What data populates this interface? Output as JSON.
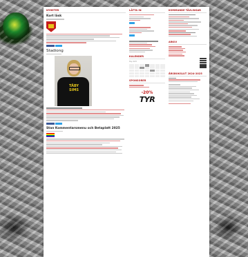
{
  "page": {
    "main": {
      "section_label": "NYHETER",
      "post1_title": "Kort läsk",
      "post2_title": "Stadiong",
      "post3_title": "Stan Kommentarsmenu och Betaplatt 2025",
      "photo_shirt_text": "TÄBY SIMS"
    },
    "middle": {
      "section1": "LÄTTA IN",
      "section2": "KALENDER",
      "calendar_month": "Maj 2025",
      "section3": "SPONSORER"
    },
    "right": {
      "section1": "KOMMANDE TÄVLINGAR",
      "section2": "ARKIV",
      "section3": "ÅRSBOKSLUT 2024-2025"
    },
    "sponsor": {
      "percent": "-20%",
      "logo": "TYR"
    },
    "colors": {
      "accent": "#b01414",
      "facebook": "#3b5998",
      "twitter": "#2ea0e6"
    }
  }
}
